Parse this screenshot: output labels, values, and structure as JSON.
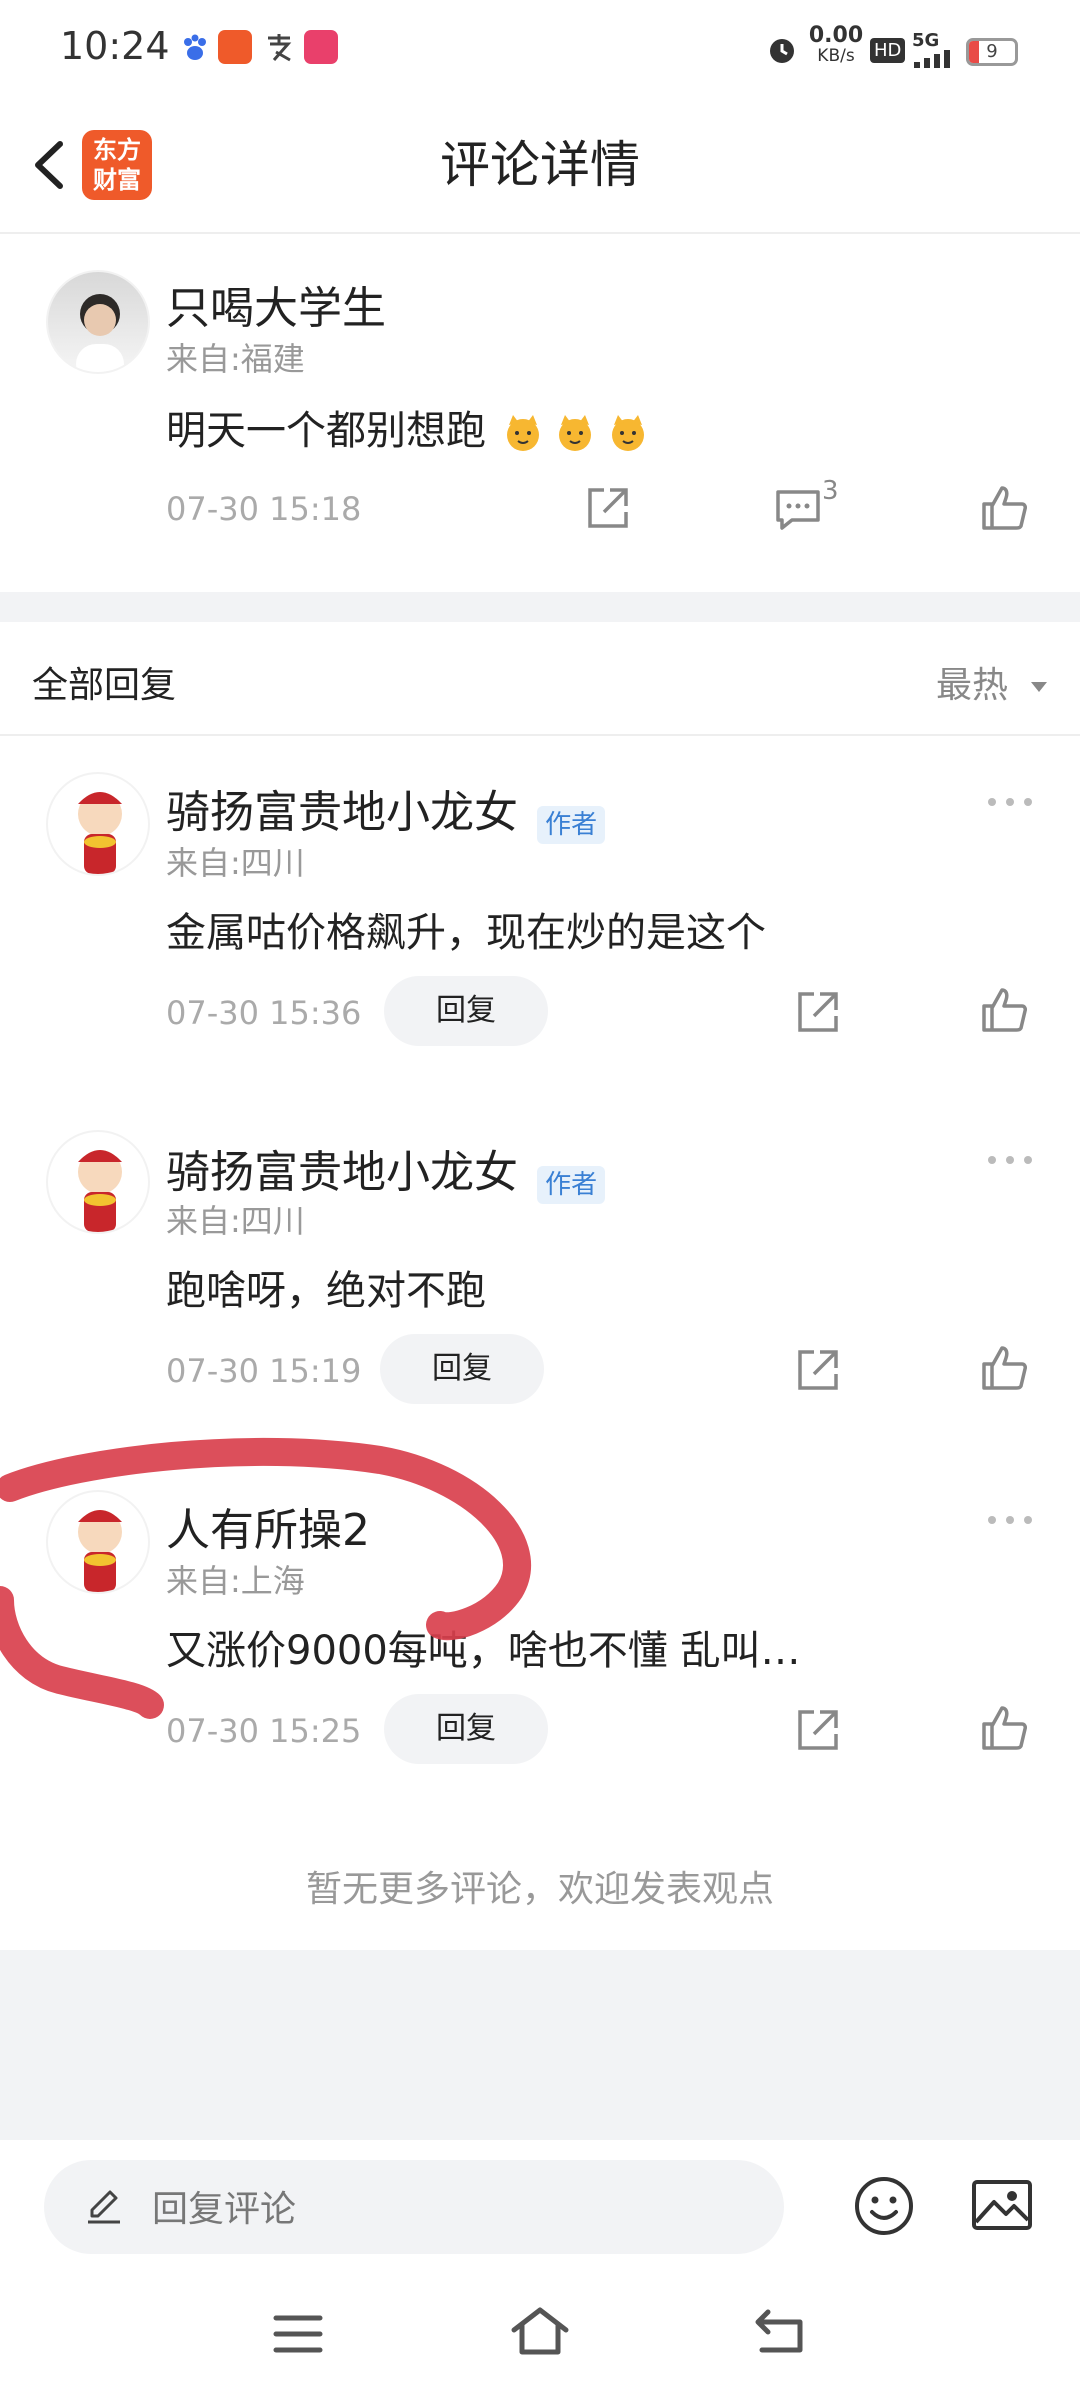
{
  "status_bar": {
    "time": "10:24",
    "net_speed_value": "0.00",
    "net_speed_unit": "KB/s",
    "hd": "HD",
    "signal": "5G",
    "battery": "9"
  },
  "header": {
    "title": "评论详情",
    "logo_line1": "东方",
    "logo_line2": "财富"
  },
  "main_comment": {
    "name": "只喝大学生",
    "location": "来自:福建",
    "content": "明天一个都别想跑",
    "datetime": "07-30 15:18",
    "reply_count": "3"
  },
  "replies_header": {
    "label": "全部回复",
    "sort": "最热"
  },
  "replies": [
    {
      "name": "骑扬富贵地小龙女",
      "badge": "作者",
      "location": "来自:四川",
      "content": "金属咕价格飙升，现在炒的是这个",
      "datetime": "07-30 15:36",
      "reply_label": "回复"
    },
    {
      "name": "骑扬富贵地小龙女",
      "badge": "作者",
      "location": "来自:四川",
      "content": "跑啥呀，绝对不跑",
      "datetime": "07-30 15:19",
      "reply_label": "回复"
    },
    {
      "name": "人有所操2",
      "location": "来自:上海",
      "content": "又涨价9000每吨，啥也不懂 乱叫…",
      "datetime": "07-30 15:25",
      "reply_label": "回复"
    }
  ],
  "footer_note": "暂无更多评论，欢迎发表观点",
  "bottom_bar": {
    "input_placeholder": "回复评论"
  },
  "colors": {
    "accent_orange": "#ef5a2a",
    "author_blue": "#3a80d4",
    "annotation_red": "#d9404d"
  }
}
